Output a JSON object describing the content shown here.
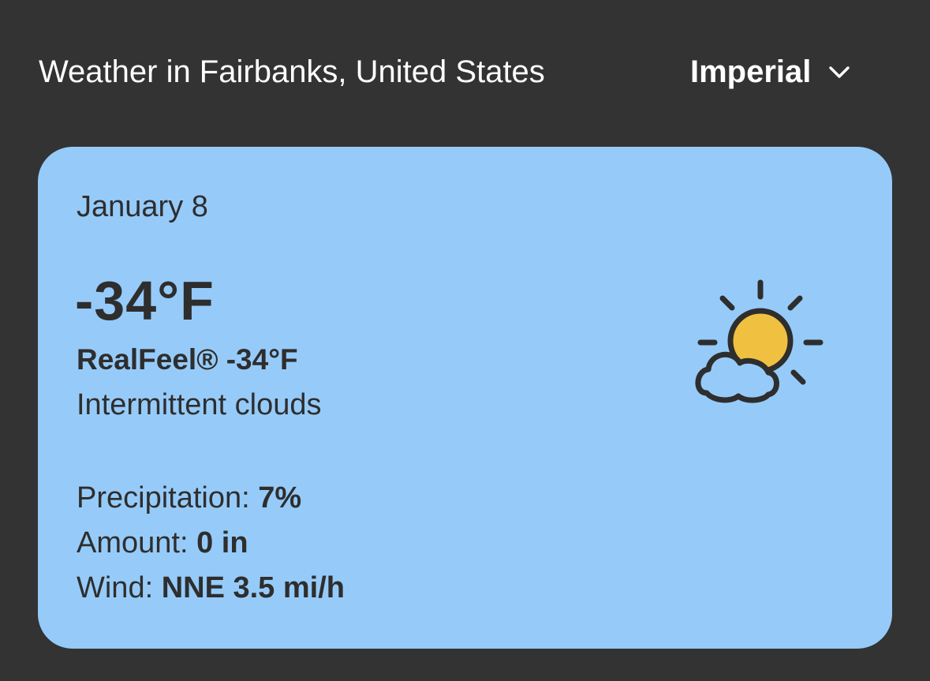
{
  "header": {
    "title": "Weather in Fairbanks, United States",
    "unit_select": {
      "selected": "Imperial",
      "icon": "chevron-down-icon"
    }
  },
  "card": {
    "date": "January 8",
    "temperature": "-34°F",
    "realfeel": "RealFeel® -34°F",
    "condition": "Intermittent clouds",
    "icon": "partly-cloudy-icon",
    "details": {
      "precipitation": {
        "label": "Precipitation:",
        "value": "7%"
      },
      "amount": {
        "label": "Amount:",
        "value": "0 in"
      },
      "wind": {
        "label": "Wind:",
        "value": "NNE 3.5 mi/h"
      }
    }
  },
  "colors": {
    "page_background": "#333333",
    "card_background": "#96cbf9",
    "text_dark": "#2e2e2e",
    "text_light": "#ffffff",
    "sun_yellow": "#f0c040"
  }
}
